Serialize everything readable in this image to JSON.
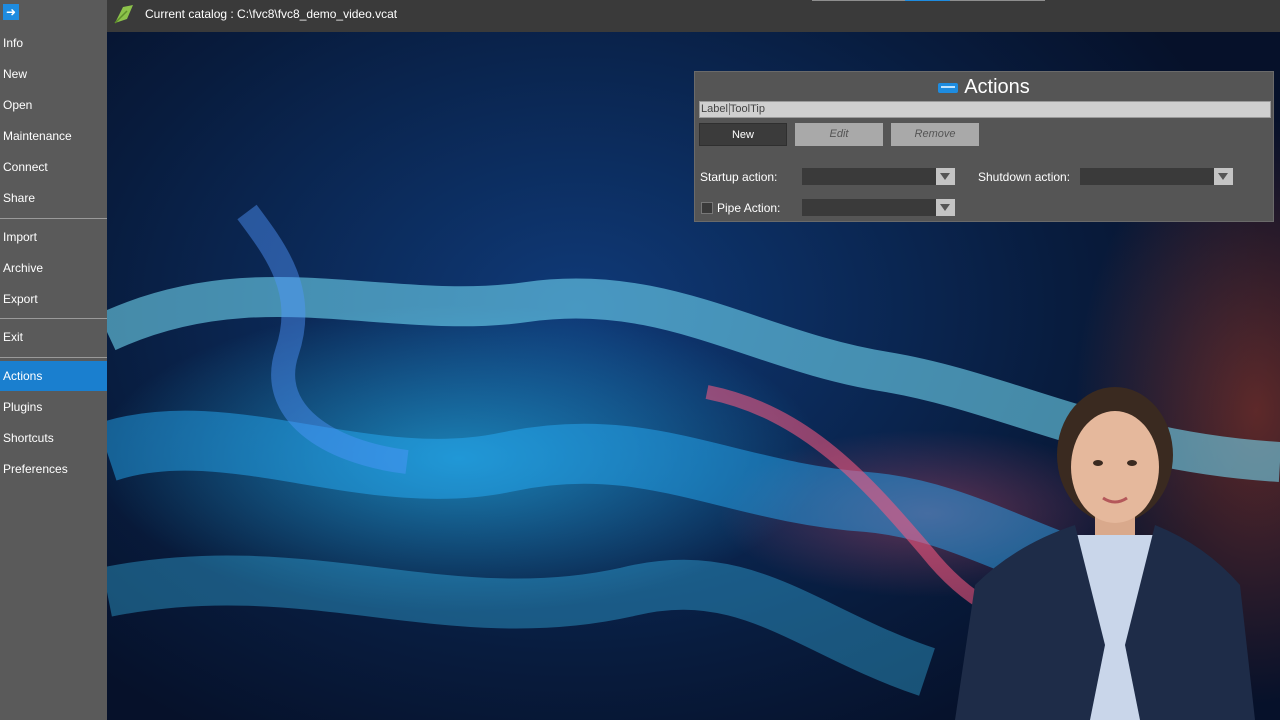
{
  "sidebar": {
    "back_icon": "arrow-right-icon",
    "items": [
      {
        "label": "Info"
      },
      {
        "label": "New"
      },
      {
        "label": "Open"
      },
      {
        "label": "Maintenance"
      },
      {
        "label": "Connect"
      },
      {
        "label": "Share"
      },
      {
        "label": "Import"
      },
      {
        "label": "Archive"
      },
      {
        "label": "Export"
      },
      {
        "label": "Exit"
      },
      {
        "label": "Actions",
        "active": true
      },
      {
        "label": "Plugins"
      },
      {
        "label": "Shortcuts"
      },
      {
        "label": "Preferences"
      }
    ]
  },
  "topbar": {
    "icon": "leaf-icon",
    "catalog_text": "Current catalog : C:\\fvc8\\fvc8_demo_video.vcat"
  },
  "actions_panel": {
    "title": "Actions",
    "tooltip_field": {
      "part1": "Label",
      "part2": "ToolTip"
    },
    "buttons": {
      "new": "New",
      "edit": "Edit",
      "remove": "Remove"
    },
    "startup_label": "Startup action:",
    "shutdown_label": "Shutdown action:",
    "pipe_label": "Pipe Action:",
    "pipe_checked": false
  },
  "colors": {
    "accent": "#1a7fcf",
    "sidebar_bg": "#5a5a5a",
    "panel_bg": "#555555"
  }
}
